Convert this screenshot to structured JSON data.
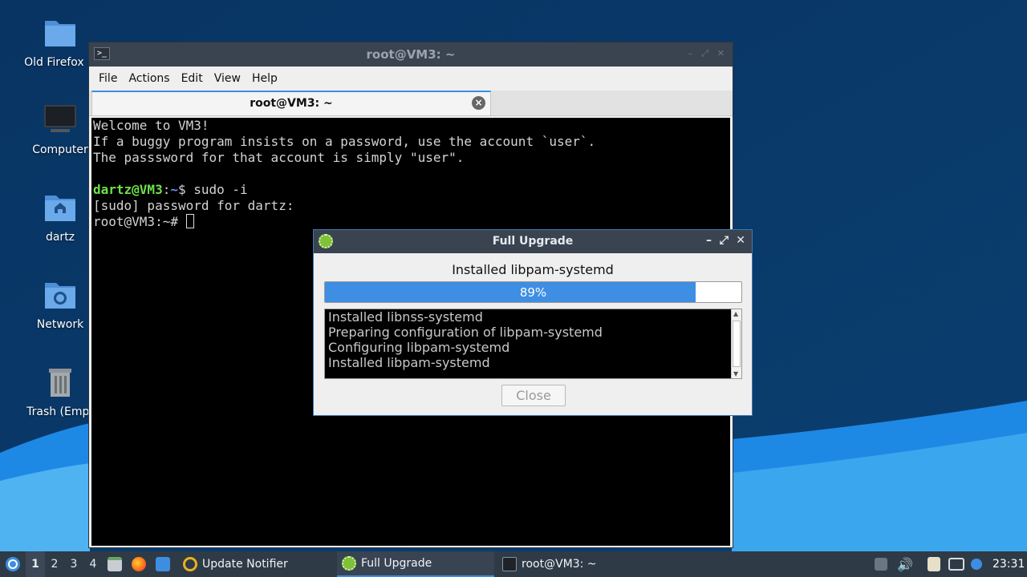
{
  "desktop": {
    "icons": [
      {
        "label": "Old Firefox D",
        "icon": "folder-icon"
      },
      {
        "label": "Computer",
        "icon": "computer-icon"
      },
      {
        "label": "dartz",
        "icon": "home-folder-icon"
      },
      {
        "label": "Network",
        "icon": "network-folder-icon"
      },
      {
        "label": "Trash (Empt",
        "icon": "trash-icon"
      }
    ]
  },
  "terminal": {
    "title": "root@VM3: ~",
    "menu": [
      "File",
      "Actions",
      "Edit",
      "View",
      "Help"
    ],
    "tab_label": "root@VM3: ~",
    "lines": [
      "Welcome to VM3!",
      "If a buggy program insists on a password, use the account `user`.",
      "The passsword for that account is simply \"user\".",
      "",
      "[sudo] password for dartz:",
      "root@VM3:~# "
    ],
    "prompt_user": "dartz@VM3",
    "prompt_sep": ":",
    "prompt_path": "~",
    "prompt_cmd": "$ sudo -i"
  },
  "dialog": {
    "title": "Full Upgrade",
    "status": "Installed libpam-systemd",
    "progress": 0.89,
    "progress_label": "89%",
    "log": [
      "Installed libnss-systemd",
      "Preparing configuration of libpam-systemd",
      "Configuring libpam-systemd",
      "Installed libpam-systemd"
    ],
    "close_label": "Close",
    "controls": {
      "minimize": "–",
      "restore": "⤢",
      "close": "✕"
    }
  },
  "taskbar": {
    "workspaces": [
      "1",
      "2",
      "3",
      "4"
    ],
    "active_workspace": "1",
    "tasks": [
      {
        "label": "Update Notifier",
        "icon": "update-notifier-icon"
      },
      {
        "label": "Full Upgrade",
        "icon": "gear-icon"
      },
      {
        "label": "root@VM3: ~",
        "icon": "terminal-icon"
      }
    ],
    "clock": "23:31"
  },
  "colors": {
    "accent": "#3d8ee0",
    "titlebar": "#3a4350",
    "terminal_bg": "#000000",
    "prompt_green": "#6ee04a",
    "prompt_blue": "#6b8fe8"
  }
}
